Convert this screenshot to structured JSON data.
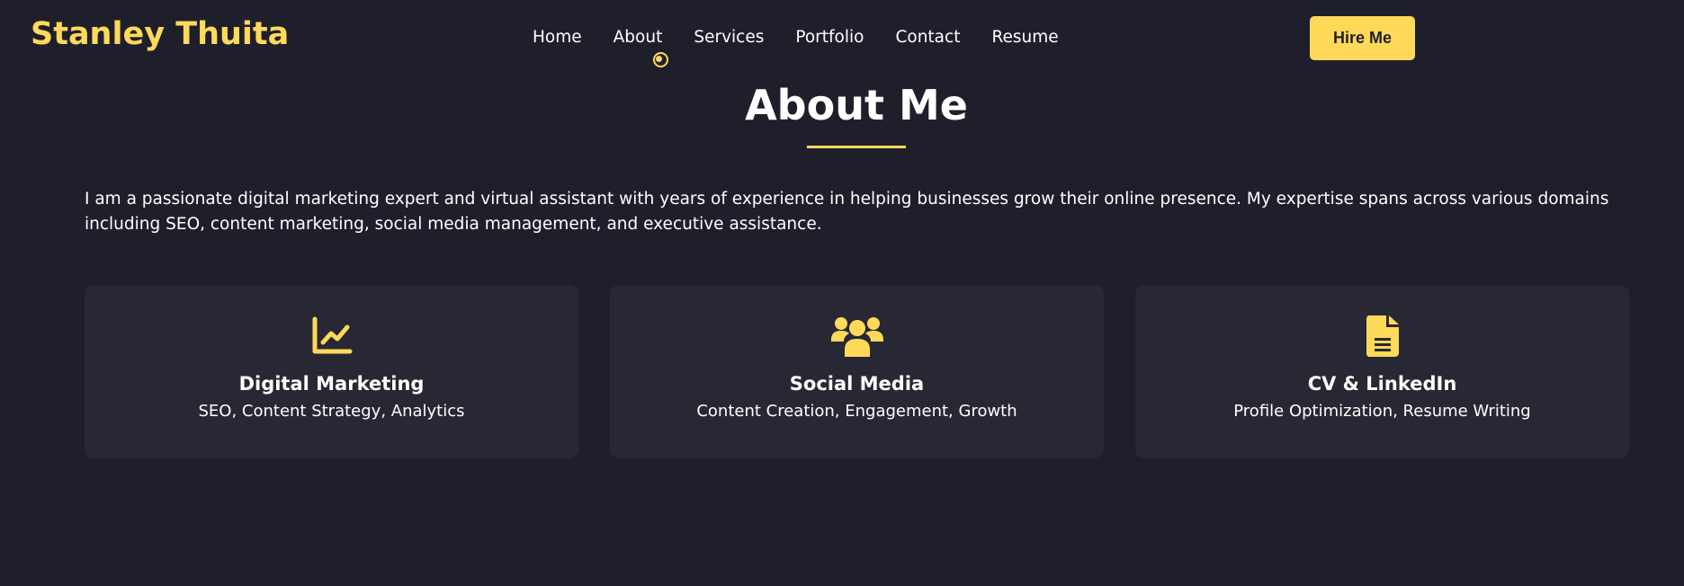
{
  "header": {
    "brand": "Stanley Thuita",
    "nav": [
      "Home",
      "About",
      "Services",
      "Portfolio",
      "Contact",
      "Resume"
    ],
    "cta_label": "Hire Me"
  },
  "about": {
    "title": "About Me",
    "intro": "I am a passionate digital marketing expert and virtual assistant with years of experience in helping businesses grow their online presence. My expertise spans across various domains including SEO, content marketing, social media management, and executive assistance.",
    "cards": [
      {
        "icon": "chart-line-icon",
        "title": "Digital Marketing",
        "subtitle": "SEO, Content Strategy, Analytics"
      },
      {
        "icon": "users-icon",
        "title": "Social Media",
        "subtitle": "Content Creation, Engagement, Growth"
      },
      {
        "icon": "file-document-icon",
        "title": "CV & LinkedIn",
        "subtitle": "Profile Optimization, Resume Writing"
      }
    ]
  },
  "colors": {
    "background": "#1f1f2c",
    "card": "#282834",
    "accent": "#ffd95a",
    "text": "#ffffff"
  }
}
